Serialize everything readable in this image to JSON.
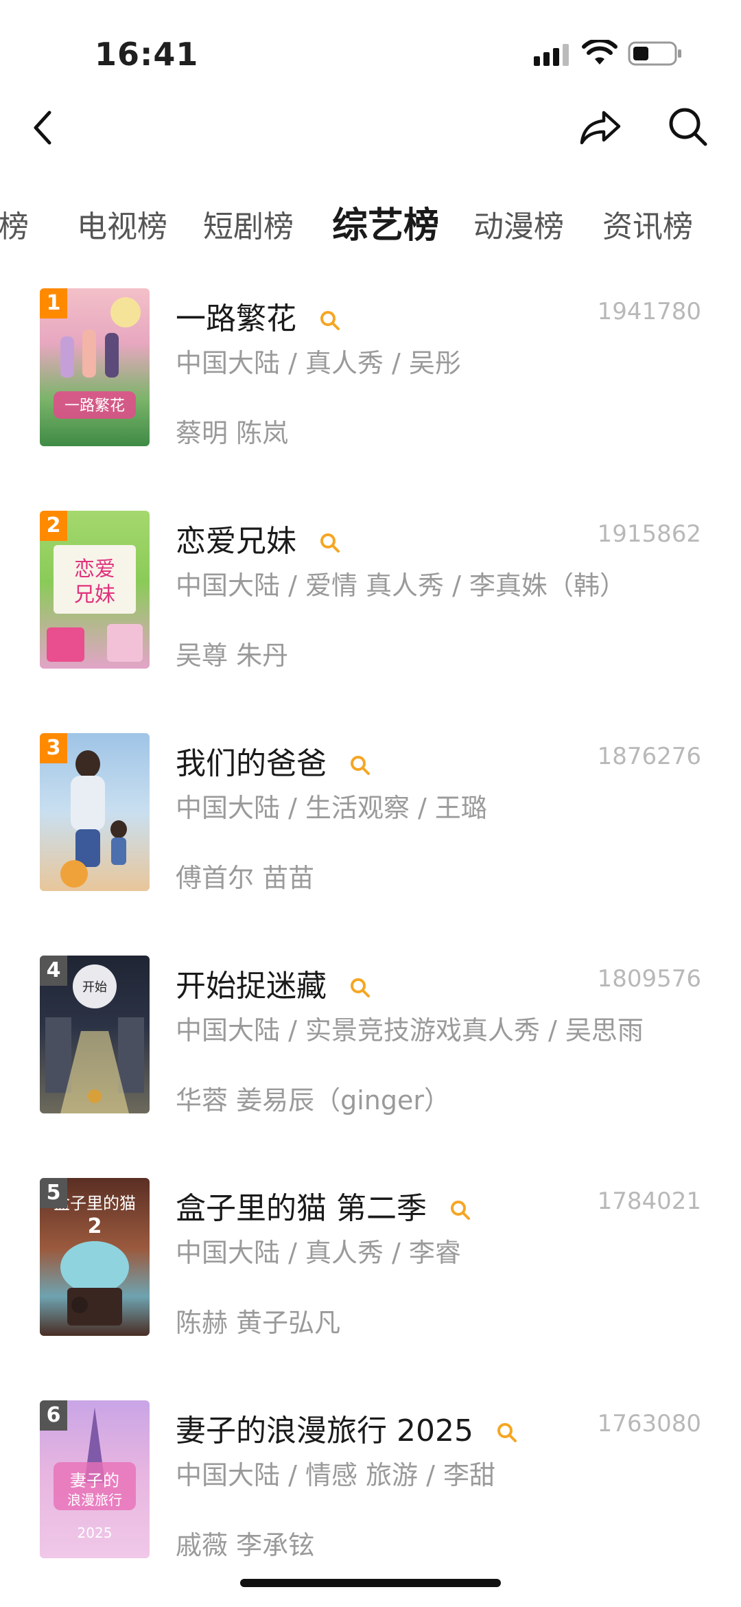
{
  "status": {
    "time": "16:41"
  },
  "tabs": [
    {
      "label": "榜",
      "active": false
    },
    {
      "label": "电视榜",
      "active": false
    },
    {
      "label": "短剧榜",
      "active": false
    },
    {
      "label": "综艺榜",
      "active": true
    },
    {
      "label": "动漫榜",
      "active": false
    },
    {
      "label": "资讯榜",
      "active": false
    }
  ],
  "items": [
    {
      "rank": "1",
      "title": "一路繁花",
      "meta": "中国大陆 / 真人秀 / 吴彤",
      "cast": "蔡明 陈岚",
      "count": "1941780"
    },
    {
      "rank": "2",
      "title": "恋爱兄妹",
      "meta": "中国大陆 / 爱情 真人秀 / 李真姝（韩）",
      "cast": "吴尊 朱丹",
      "count": "1915862"
    },
    {
      "rank": "3",
      "title": "我们的爸爸",
      "meta": "中国大陆 / 生活观察 / 王璐",
      "cast": "傅首尔 苗苗",
      "count": "1876276"
    },
    {
      "rank": "4",
      "title": "开始捉迷藏",
      "meta": "中国大陆 / 实景竞技游戏真人秀 / 吴思雨",
      "cast": "华蓉 姜易辰（ginger）",
      "count": "1809576"
    },
    {
      "rank": "5",
      "title": "盒子里的猫 第二季",
      "meta": "中国大陆 / 真人秀 / 李睿",
      "cast": "陈赫 黄子弘凡",
      "count": "1784021"
    },
    {
      "rank": "6",
      "title": "妻子的浪漫旅行 2025",
      "meta": "中国大陆 / 情感 旅游 / 李甜",
      "cast": "戚薇 李承铉",
      "count": "1763080"
    }
  ],
  "colors": {
    "rank_top": "#ff8a00",
    "rank_other": "#555555",
    "search_accent": "#f5a623"
  },
  "icons": {
    "back": "chevron-left-icon",
    "share": "share-icon",
    "search": "search-icon",
    "title_search": "search-icon"
  }
}
